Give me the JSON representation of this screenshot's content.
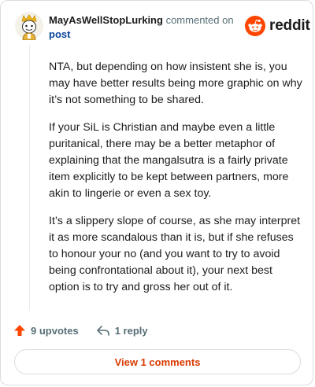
{
  "comment": {
    "username": "MayAsWellStopLurking",
    "action_text": "commented on",
    "post_link": "post",
    "paragraphs": [
      "NTA, but depending on how insistent she is, you may have better results being more graphic on why it’s not something to be shared.",
      "If your SiL is Christian and maybe even a little puritanical, there may be a better metaphor of explaining that the mangalsutra is a fairly private item explicitly to be kept between partners, more akin to lingerie or even a sex toy.",
      "It’s a slippery slope of course, as she may interpret it as more scandalous than it is, but if she refuses to honour your no (and you want to try to avoid being confrontational about it), your next best option is to try and gross her out of it."
    ]
  },
  "brand": {
    "wordmark": "reddit",
    "icon": "reddit-logo-icon",
    "color": "#ff4500"
  },
  "actions": {
    "upvotes": "9 upvotes",
    "replies": "1 reply",
    "upvote_icon": "upvote-arrow-icon",
    "reply_icon": "reply-arrow-icon"
  },
  "view_button": "View 1 comments",
  "colors": {
    "accent": "#d93a00",
    "link": "#0a449b",
    "upvote": "#ff4500"
  }
}
